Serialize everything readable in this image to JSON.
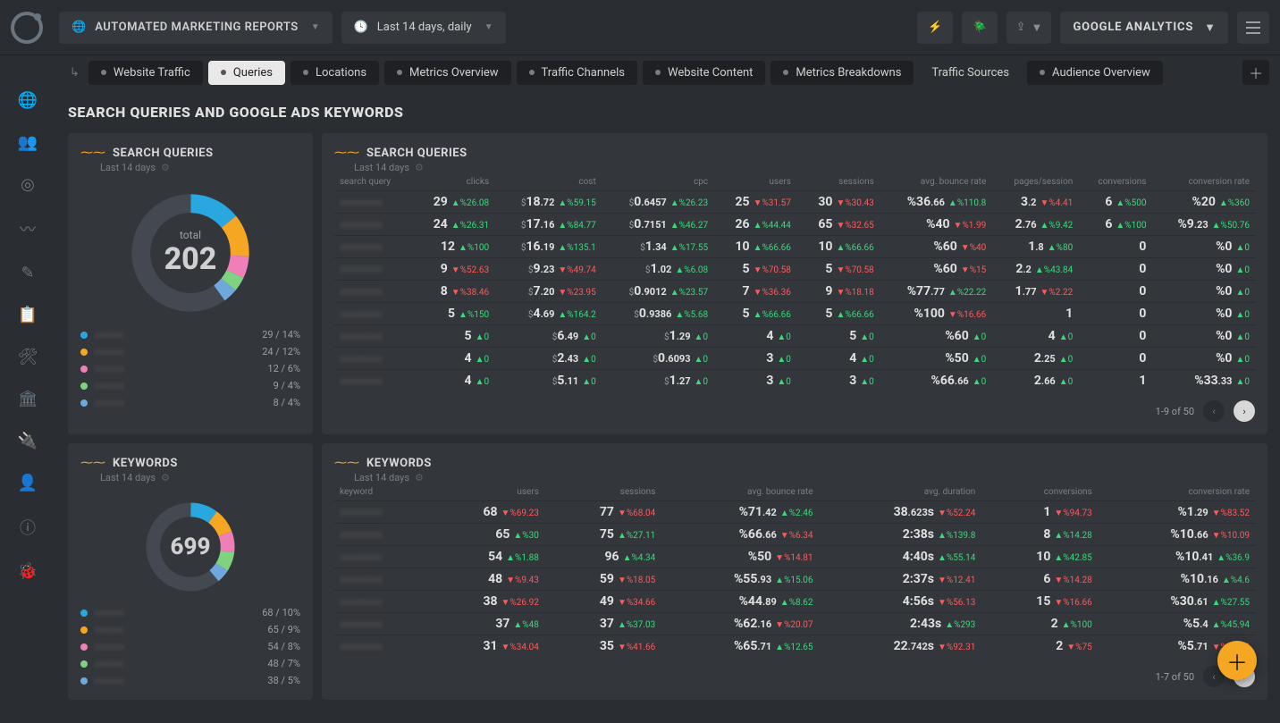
{
  "header": {
    "report_label": "AUTOMATED MARKETING REPORTS",
    "date_label": "Last 14 days, daily",
    "source_label": "GOOGLE ANALYTICS"
  },
  "tabs": [
    "Website Traffic",
    "Queries",
    "Locations",
    "Metrics Overview",
    "Traffic Channels",
    "Website Content",
    "Metrics Breakdowns",
    "Traffic Sources",
    "Audience Overview"
  ],
  "active_tab": 1,
  "page_title": "SEARCH QUERIES AND GOOGLE ADS KEYWORDS",
  "sq_small": {
    "title": "SEARCH QUERIES",
    "sub": "Last 14 days",
    "total_label": "total",
    "total_value": "202",
    "legend": [
      {
        "color": "#29a7df",
        "count": 29,
        "pct": 14
      },
      {
        "color": "#f5a623",
        "count": 24,
        "pct": 12
      },
      {
        "color": "#ef7fb6",
        "count": 12,
        "pct": 6
      },
      {
        "color": "#7fd27f",
        "count": 9,
        "pct": 4
      },
      {
        "color": "#6fa8dc",
        "count": 8,
        "pct": 4
      }
    ]
  },
  "sq_table": {
    "title": "SEARCH QUERIES",
    "sub": "Last 14 days",
    "cols": [
      "search query",
      "clicks",
      "cost",
      "cpc",
      "users",
      "sessions",
      "avg. bounce rate",
      "pages/session",
      "conversions",
      "conversion rate"
    ],
    "rows": [
      {
        "clicks": {
          "v": "29",
          "d": "▲%26.08",
          "dir": "up"
        },
        "cost": {
          "v": "$18.72",
          "d": "▲%59.15",
          "dir": "up"
        },
        "cpc": {
          "v": "$0.6457",
          "d": "▲%26.23",
          "dir": "up"
        },
        "users": {
          "v": "25",
          "d": "▼%31.57",
          "dir": "dn"
        },
        "sessions": {
          "v": "30",
          "d": "▼%30.43",
          "dir": "dn"
        },
        "bounce": {
          "v": "%36.66",
          "d": "▲%110.8",
          "dir": "up"
        },
        "pps": {
          "v": "3.2",
          "d": "▼%4.41",
          "dir": "dn"
        },
        "conv": {
          "v": "6",
          "d": "▲%500",
          "dir": "up"
        },
        "cr": {
          "v": "%20",
          "d": "▲%360",
          "dir": "up"
        }
      },
      {
        "clicks": {
          "v": "24",
          "d": "▲%26.31",
          "dir": "up"
        },
        "cost": {
          "v": "$17.16",
          "d": "▲%84.77",
          "dir": "up"
        },
        "cpc": {
          "v": "$0.7151",
          "d": "▲%46.27",
          "dir": "up"
        },
        "users": {
          "v": "26",
          "d": "▲%44.44",
          "dir": "up"
        },
        "sessions": {
          "v": "65",
          "d": "▼%32.65",
          "dir": "dn"
        },
        "bounce": {
          "v": "%40",
          "d": "▼%1.99",
          "dir": "dn"
        },
        "pps": {
          "v": "2.76",
          "d": "▲%9.42",
          "dir": "up"
        },
        "conv": {
          "v": "6",
          "d": "▲%100",
          "dir": "up"
        },
        "cr": {
          "v": "%9.23",
          "d": "▲%50.76",
          "dir": "up"
        }
      },
      {
        "clicks": {
          "v": "12",
          "d": "▲%100",
          "dir": "up"
        },
        "cost": {
          "v": "$16.19",
          "d": "▲%135.1",
          "dir": "up"
        },
        "cpc": {
          "v": "$1.34",
          "d": "▲%17.55",
          "dir": "up"
        },
        "users": {
          "v": "10",
          "d": "▲%66.66",
          "dir": "up"
        },
        "sessions": {
          "v": "10",
          "d": "▲%66.66",
          "dir": "up"
        },
        "bounce": {
          "v": "%60",
          "d": "▼%40",
          "dir": "dn"
        },
        "pps": {
          "v": "1.8",
          "d": "▲%80",
          "dir": "up"
        },
        "conv": {
          "v": "0",
          "d": "",
          "dir": ""
        },
        "cr": {
          "v": "%0",
          "d": "▲0",
          "dir": "up"
        }
      },
      {
        "clicks": {
          "v": "9",
          "d": "▼%52.63",
          "dir": "dn"
        },
        "cost": {
          "v": "$9.23",
          "d": "▼%49.74",
          "dir": "dn"
        },
        "cpc": {
          "v": "$1.02",
          "d": "▲%6.08",
          "dir": "up"
        },
        "users": {
          "v": "5",
          "d": "▼%70.58",
          "dir": "dn"
        },
        "sessions": {
          "v": "5",
          "d": "▼%70.58",
          "dir": "dn"
        },
        "bounce": {
          "v": "%60",
          "d": "▼%15",
          "dir": "dn"
        },
        "pps": {
          "v": "2.2",
          "d": "▲%43.84",
          "dir": "up"
        },
        "conv": {
          "v": "0",
          "d": "",
          "dir": ""
        },
        "cr": {
          "v": "%0",
          "d": "▲0",
          "dir": "up"
        }
      },
      {
        "clicks": {
          "v": "8",
          "d": "▼%38.46",
          "dir": "dn"
        },
        "cost": {
          "v": "$7.20",
          "d": "▼%23.95",
          "dir": "dn"
        },
        "cpc": {
          "v": "$0.9012",
          "d": "▲%23.57",
          "dir": "up"
        },
        "users": {
          "v": "7",
          "d": "▼%36.36",
          "dir": "dn"
        },
        "sessions": {
          "v": "9",
          "d": "▼%18.18",
          "dir": "dn"
        },
        "bounce": {
          "v": "%77.77",
          "d": "▲%22.22",
          "dir": "up"
        },
        "pps": {
          "v": "1.77",
          "d": "▼%2.22",
          "dir": "dn"
        },
        "conv": {
          "v": "0",
          "d": "",
          "dir": ""
        },
        "cr": {
          "v": "%0",
          "d": "▲0",
          "dir": "up"
        }
      },
      {
        "clicks": {
          "v": "5",
          "d": "▲%150",
          "dir": "up"
        },
        "cost": {
          "v": "$4.69",
          "d": "▲%164.2",
          "dir": "up"
        },
        "cpc": {
          "v": "$0.9386",
          "d": "▲%5.68",
          "dir": "up"
        },
        "users": {
          "v": "5",
          "d": "▲%66.66",
          "dir": "up"
        },
        "sessions": {
          "v": "5",
          "d": "▲%66.66",
          "dir": "up"
        },
        "bounce": {
          "v": "%100",
          "d": "▼%16.66",
          "dir": "dn"
        },
        "pps": {
          "v": "1",
          "d": "",
          "dir": ""
        },
        "conv": {
          "v": "0",
          "d": "",
          "dir": ""
        },
        "cr": {
          "v": "%0",
          "d": "▲0",
          "dir": "up"
        }
      },
      {
        "clicks": {
          "v": "5",
          "d": "▲0",
          "dir": "up"
        },
        "cost": {
          "v": "$6.49",
          "d": "▲0",
          "dir": "up"
        },
        "cpc": {
          "v": "$1.29",
          "d": "▲0",
          "dir": "up"
        },
        "users": {
          "v": "4",
          "d": "▲0",
          "dir": "up"
        },
        "sessions": {
          "v": "5",
          "d": "▲0",
          "dir": "up"
        },
        "bounce": {
          "v": "%60",
          "d": "▲0",
          "dir": "up"
        },
        "pps": {
          "v": "4",
          "d": "▲0",
          "dir": "up"
        },
        "conv": {
          "v": "0",
          "d": "",
          "dir": ""
        },
        "cr": {
          "v": "%0",
          "d": "▲0",
          "dir": "up"
        }
      },
      {
        "clicks": {
          "v": "4",
          "d": "▲0",
          "dir": "up"
        },
        "cost": {
          "v": "$2.43",
          "d": "▲0",
          "dir": "up"
        },
        "cpc": {
          "v": "$0.6093",
          "d": "▲0",
          "dir": "up"
        },
        "users": {
          "v": "3",
          "d": "▲0",
          "dir": "up"
        },
        "sessions": {
          "v": "4",
          "d": "▲0",
          "dir": "up"
        },
        "bounce": {
          "v": "%50",
          "d": "▲0",
          "dir": "up"
        },
        "pps": {
          "v": "2.25",
          "d": "▲0",
          "dir": "up"
        },
        "conv": {
          "v": "0",
          "d": "",
          "dir": ""
        },
        "cr": {
          "v": "%0",
          "d": "▲0",
          "dir": "up"
        }
      },
      {
        "clicks": {
          "v": "4",
          "d": "▲0",
          "dir": "up"
        },
        "cost": {
          "v": "$5.11",
          "d": "▲0",
          "dir": "up"
        },
        "cpc": {
          "v": "$1.27",
          "d": "▲0",
          "dir": "up"
        },
        "users": {
          "v": "3",
          "d": "▲0",
          "dir": "up"
        },
        "sessions": {
          "v": "3",
          "d": "▲0",
          "dir": "up"
        },
        "bounce": {
          "v": "%66.66",
          "d": "▲0",
          "dir": "up"
        },
        "pps": {
          "v": "2.66",
          "d": "▲0",
          "dir": "up"
        },
        "conv": {
          "v": "1",
          "d": "",
          "dir": ""
        },
        "cr": {
          "v": "%33.33",
          "d": "▲0",
          "dir": "up"
        }
      }
    ],
    "pager": "1-9 of 50"
  },
  "kw_small": {
    "title": "KEYWORDS",
    "sub": "Last 14 days",
    "total_value": "699",
    "legend": [
      {
        "color": "#29a7df",
        "count": 68,
        "pct": 10
      },
      {
        "color": "#f5a623",
        "count": 65,
        "pct": 9
      },
      {
        "color": "#ef7fb6",
        "count": 54,
        "pct": 8
      },
      {
        "color": "#7fd27f",
        "count": 48,
        "pct": 7
      },
      {
        "color": "#6fa8dc",
        "count": 38,
        "pct": 5
      }
    ]
  },
  "kw_table": {
    "title": "KEYWORDS",
    "sub": "Last 14 days",
    "cols": [
      "keyword",
      "users",
      "sessions",
      "avg. bounce rate",
      "avg. duration",
      "conversions",
      "conversion rate"
    ],
    "rows": [
      {
        "users": {
          "v": "68",
          "d": "▼%69.23",
          "dir": "dn"
        },
        "sessions": {
          "v": "77",
          "d": "▼%68.04",
          "dir": "dn"
        },
        "bounce": {
          "v": "%71.42",
          "d": "▲%2.46",
          "dir": "up"
        },
        "dur": {
          "v": "38.623s",
          "d": "▼%52.24",
          "dir": "dn"
        },
        "conv": {
          "v": "1",
          "d": "▼%94.73",
          "dir": "dn"
        },
        "cr": {
          "v": "%1.29",
          "d": "▼%83.52",
          "dir": "dn"
        }
      },
      {
        "users": {
          "v": "65",
          "d": "▲%30",
          "dir": "up"
        },
        "sessions": {
          "v": "75",
          "d": "▲%27.11",
          "dir": "up"
        },
        "bounce": {
          "v": "%66.66",
          "d": "▼%6.34",
          "dir": "dn"
        },
        "dur": {
          "v": "2:38s",
          "d": "▲%139.8",
          "dir": "up"
        },
        "conv": {
          "v": "8",
          "d": "▲%14.28",
          "dir": "up"
        },
        "cr": {
          "v": "%10.66",
          "d": "▼%10.09",
          "dir": "dn"
        }
      },
      {
        "users": {
          "v": "54",
          "d": "▲%1.88",
          "dir": "up"
        },
        "sessions": {
          "v": "96",
          "d": "▲%4.34",
          "dir": "up"
        },
        "bounce": {
          "v": "%50",
          "d": "▼%14.81",
          "dir": "dn"
        },
        "dur": {
          "v": "4:40s",
          "d": "▲%55.14",
          "dir": "up"
        },
        "conv": {
          "v": "10",
          "d": "▲%42.85",
          "dir": "up"
        },
        "cr": {
          "v": "%10.41",
          "d": "▲%36.9",
          "dir": "up"
        }
      },
      {
        "users": {
          "v": "48",
          "d": "▼%9.43",
          "dir": "dn"
        },
        "sessions": {
          "v": "59",
          "d": "▼%18.05",
          "dir": "dn"
        },
        "bounce": {
          "v": "%55.93",
          "d": "▲%15.06",
          "dir": "up"
        },
        "dur": {
          "v": "2:37s",
          "d": "▼%12.41",
          "dir": "dn"
        },
        "conv": {
          "v": "6",
          "d": "▼%14.28",
          "dir": "dn"
        },
        "cr": {
          "v": "%10.16",
          "d": "▲%4.6",
          "dir": "up"
        }
      },
      {
        "users": {
          "v": "38",
          "d": "▼%26.92",
          "dir": "dn"
        },
        "sessions": {
          "v": "49",
          "d": "▼%34.66",
          "dir": "dn"
        },
        "bounce": {
          "v": "%44.89",
          "d": "▲%8.62",
          "dir": "up"
        },
        "dur": {
          "v": "4:56s",
          "d": "▼%56.13",
          "dir": "dn"
        },
        "conv": {
          "v": "15",
          "d": "▼%16.66",
          "dir": "dn"
        },
        "cr": {
          "v": "%30.61",
          "d": "▲%27.55",
          "dir": "up"
        }
      },
      {
        "users": {
          "v": "37",
          "d": "▲%48",
          "dir": "up"
        },
        "sessions": {
          "v": "37",
          "d": "▲%37.03",
          "dir": "up"
        },
        "bounce": {
          "v": "%62.16",
          "d": "▼%20.07",
          "dir": "dn"
        },
        "dur": {
          "v": "2:43s",
          "d": "▲%293",
          "dir": "up"
        },
        "conv": {
          "v": "2",
          "d": "▲%100",
          "dir": "up"
        },
        "cr": {
          "v": "%5.4",
          "d": "▲%45.94",
          "dir": "up"
        }
      },
      {
        "users": {
          "v": "31",
          "d": "▼%34.04",
          "dir": "dn"
        },
        "sessions": {
          "v": "35",
          "d": "▼%41.66",
          "dir": "dn"
        },
        "bounce": {
          "v": "%65.71",
          "d": "▲%12.65",
          "dir": "up"
        },
        "dur": {
          "v": "22.742s",
          "d": "▼%92.31",
          "dir": "dn"
        },
        "conv": {
          "v": "2",
          "d": "▼%75",
          "dir": "dn"
        },
        "cr": {
          "v": "%5.71",
          "d": "▼%57.14",
          "dir": "dn"
        }
      }
    ],
    "pager": "1-7 of 50"
  },
  "chart_data": [
    {
      "type": "pie",
      "title": "SEARCH QUERIES",
      "total": 202,
      "slices": [
        {
          "value": 29,
          "pct": 14,
          "color": "#29a7df"
        },
        {
          "value": 24,
          "pct": 12,
          "color": "#f5a623"
        },
        {
          "value": 12,
          "pct": 6,
          "color": "#ef7fb6"
        },
        {
          "value": 9,
          "pct": 4,
          "color": "#7fd27f"
        },
        {
          "value": 8,
          "pct": 4,
          "color": "#6fa8dc"
        },
        {
          "value": 120,
          "pct": 60,
          "color": "#5a5f67"
        }
      ]
    },
    {
      "type": "pie",
      "title": "KEYWORDS",
      "total": 699,
      "slices": [
        {
          "value": 68,
          "pct": 10,
          "color": "#29a7df"
        },
        {
          "value": 65,
          "pct": 9,
          "color": "#f5a623"
        },
        {
          "value": 54,
          "pct": 8,
          "color": "#ef7fb6"
        },
        {
          "value": 48,
          "pct": 7,
          "color": "#7fd27f"
        },
        {
          "value": 38,
          "pct": 5,
          "color": "#6fa8dc"
        },
        {
          "value": 426,
          "pct": 61,
          "color": "#5a5f67"
        }
      ]
    }
  ]
}
